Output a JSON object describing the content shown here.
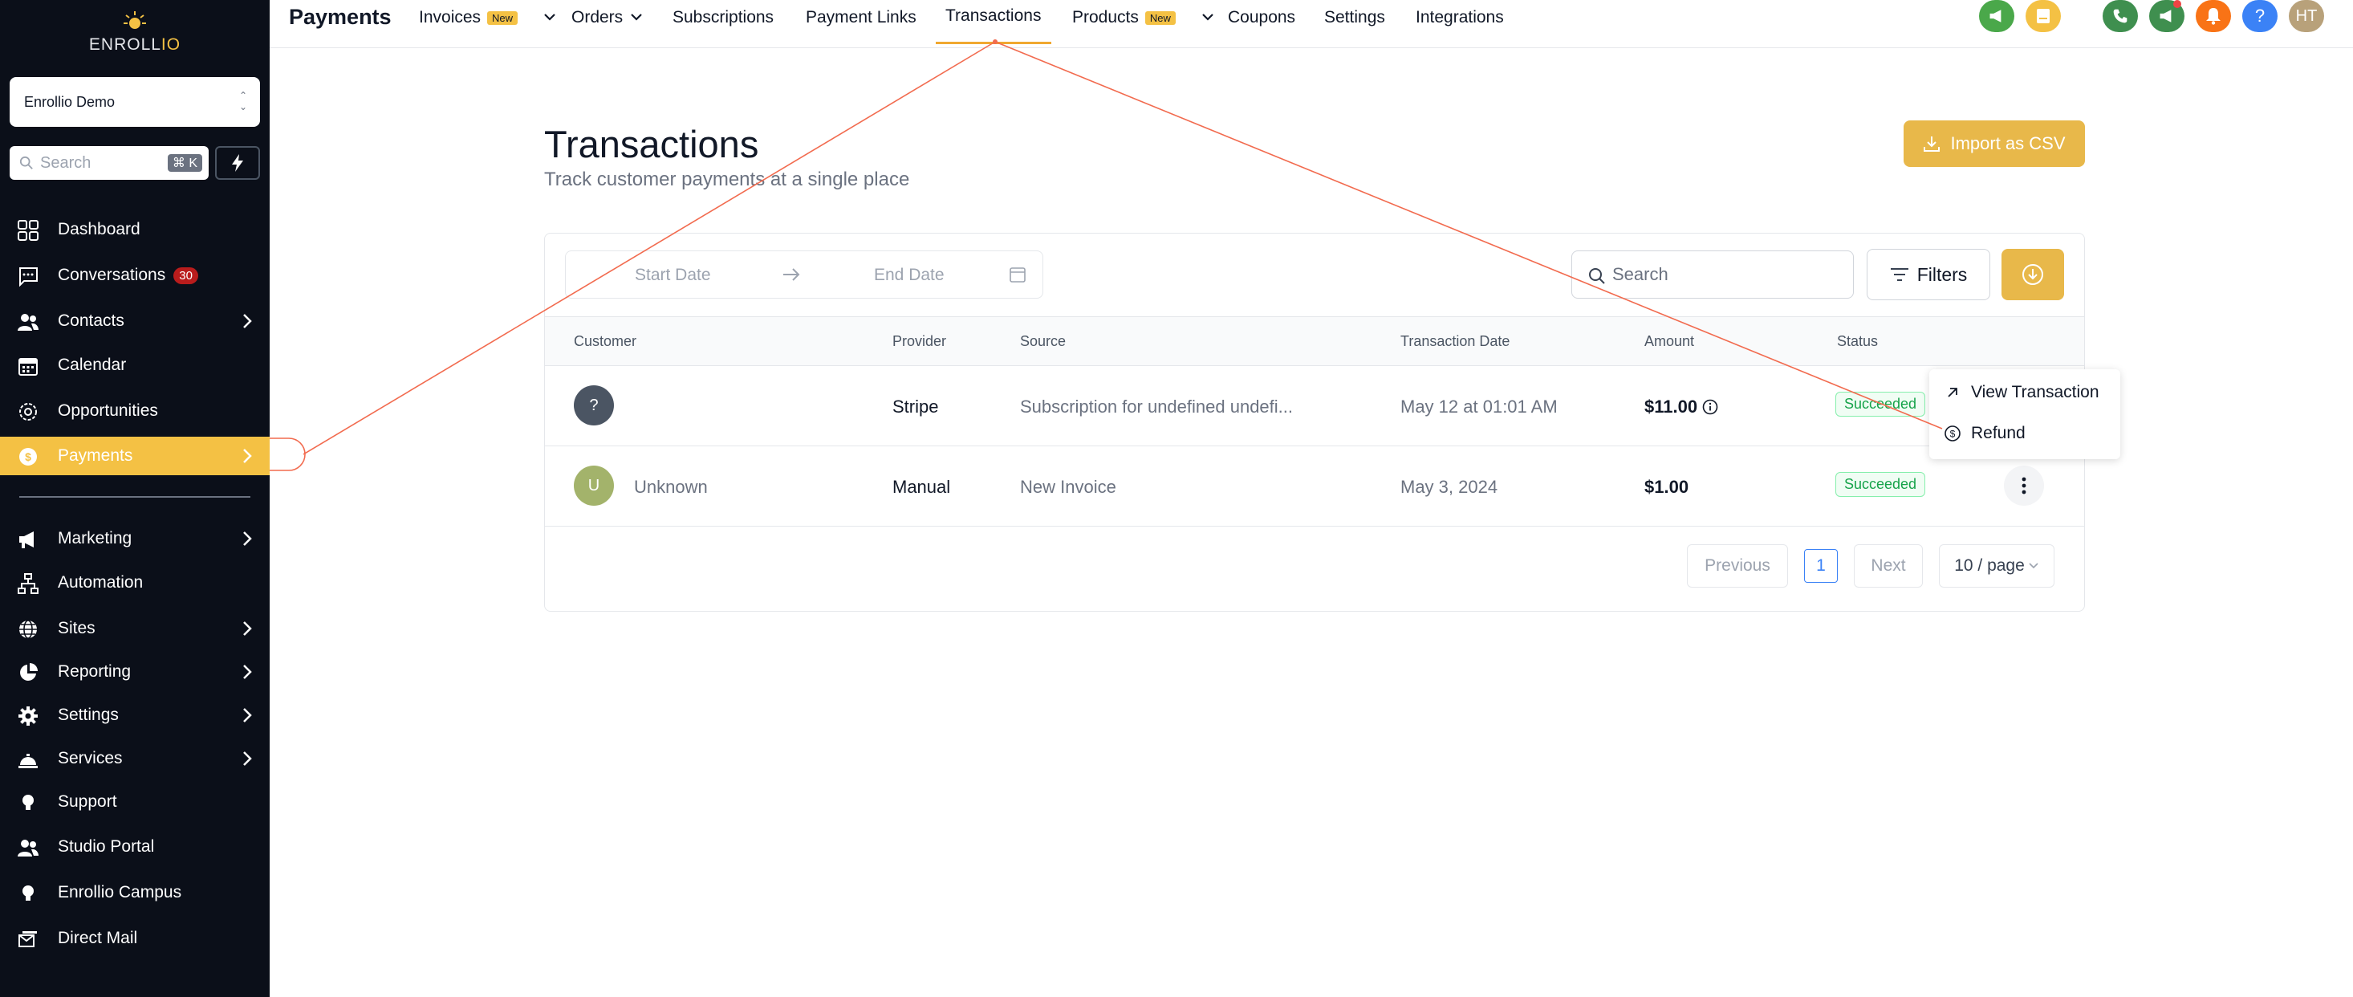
{
  "brand": {
    "logo_prefix": "ENROLL",
    "logo_suffix": "IO",
    "location": "Enrollio Demo"
  },
  "sidebar": {
    "search_placeholder": "Search",
    "search_shortcut": "⌘ K",
    "items": [
      {
        "label": "Dashboard"
      },
      {
        "label": "Conversations",
        "badge": "30"
      },
      {
        "label": "Contacts"
      },
      {
        "label": "Calendar"
      },
      {
        "label": "Opportunities"
      },
      {
        "label": "Payments"
      },
      {
        "label": "Marketing"
      },
      {
        "label": "Automation"
      },
      {
        "label": "Sites"
      },
      {
        "label": "Reporting"
      },
      {
        "label": "Settings"
      },
      {
        "label": "Services"
      },
      {
        "label": "Support"
      },
      {
        "label": "Studio Portal"
      },
      {
        "label": "Enrollio Campus"
      },
      {
        "label": "Direct Mail"
      }
    ]
  },
  "topbar": {
    "title": "Payments",
    "tabs": [
      {
        "label": "Invoices",
        "badge": "New"
      },
      {
        "label": "Orders"
      },
      {
        "label": "Subscriptions"
      },
      {
        "label": "Payment Links"
      },
      {
        "label": "Transactions"
      },
      {
        "label": "Products",
        "badge": "New"
      },
      {
        "label": "Coupons"
      },
      {
        "label": "Settings"
      },
      {
        "label": "Integrations"
      }
    ],
    "help_label": "?",
    "user_initials": "HT"
  },
  "page": {
    "title": "Transactions",
    "subtitle": "Track customer payments at a single place",
    "import_label": "Import as CSV",
    "start_date_placeholder": "Start Date",
    "end_date_placeholder": "End Date",
    "search_placeholder": "Search",
    "filters_label": "Filters"
  },
  "table": {
    "columns": [
      "Customer",
      "Provider",
      "Source",
      "Transaction Date",
      "Amount",
      "Status"
    ],
    "rows": [
      {
        "avatar": "?",
        "customer": "",
        "provider": "Stripe",
        "source": "Subscription for undefined undefi...",
        "date": "May 12 at 01:01 AM",
        "amount": "$11.00",
        "status": "Succeeded"
      },
      {
        "avatar": "U",
        "customer": "Unknown",
        "provider": "Manual",
        "source": "New Invoice",
        "date": "May 3, 2024",
        "amount": "$1.00",
        "status": "Succeeded"
      }
    ]
  },
  "pagination": {
    "previous": "Previous",
    "page": "1",
    "next": "Next",
    "per_page": "10 / page"
  },
  "row_menu": {
    "view": "View Transaction",
    "refund": "Refund"
  },
  "colors": {
    "accent": "#f4c144",
    "sidebar_bg": "#0b0f19",
    "annotation": "#f26b4f",
    "success": "#16a34a"
  }
}
